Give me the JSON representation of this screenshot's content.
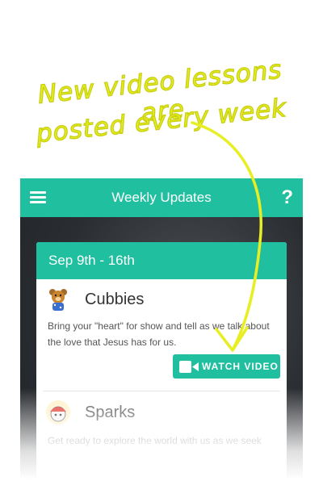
{
  "promo": {
    "line1": "New video lessons are",
    "line2": "posted every week"
  },
  "appbar": {
    "title": "Weekly Updates",
    "help_glyph": "?"
  },
  "card": {
    "date_range": "Sep 9th - 16th",
    "items": [
      {
        "name": "Cubbies",
        "description": "Bring your \"heart\" for show and tell as we talk about the love that Jesus has for us.",
        "button_label": "WATCH VIDEO"
      },
      {
        "name": "Sparks",
        "description": "Get ready to explore the world with us as we seek"
      }
    ]
  },
  "colors": {
    "accent": "#1fbf9f",
    "promo_text": "#e7ef24"
  },
  "icons": {
    "menu": "hamburger-menu-icon",
    "help": "question-mark-icon",
    "video": "video-camera-icon"
  }
}
